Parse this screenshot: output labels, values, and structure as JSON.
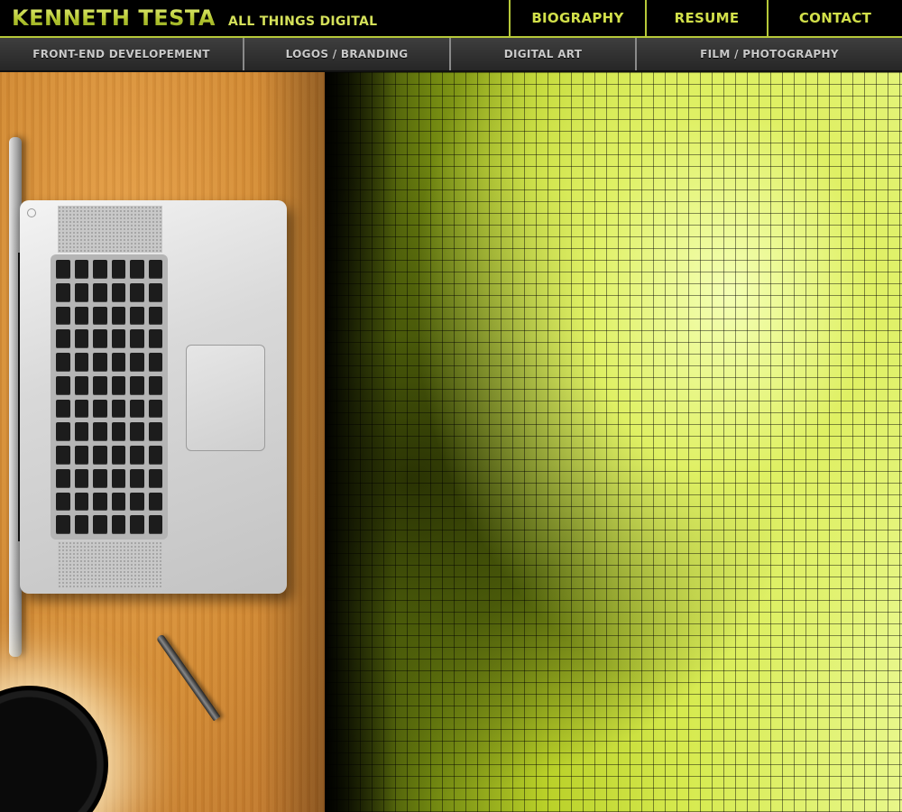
{
  "brand": {
    "name": "KENNETH TESTA",
    "tagline": "ALL THINGS DIGITAL"
  },
  "topnav": [
    {
      "label": "BIOGRAPHY"
    },
    {
      "label": "RESUME"
    },
    {
      "label": "CONTACT"
    }
  ],
  "subnav": [
    {
      "label": "FRONT-END DEVELOPEMENT"
    },
    {
      "label": "LOGOS / BRANDING"
    },
    {
      "label": "DIGITAL ART"
    },
    {
      "label": "FILM / PHOTOGRAPHY"
    }
  ],
  "colors": {
    "accent": "#b6c939",
    "nav_text": "#d2e04a",
    "subnav_bg": "#2e2e2e",
    "desk": "#d38b35",
    "mosaic": "#c6dc35"
  }
}
